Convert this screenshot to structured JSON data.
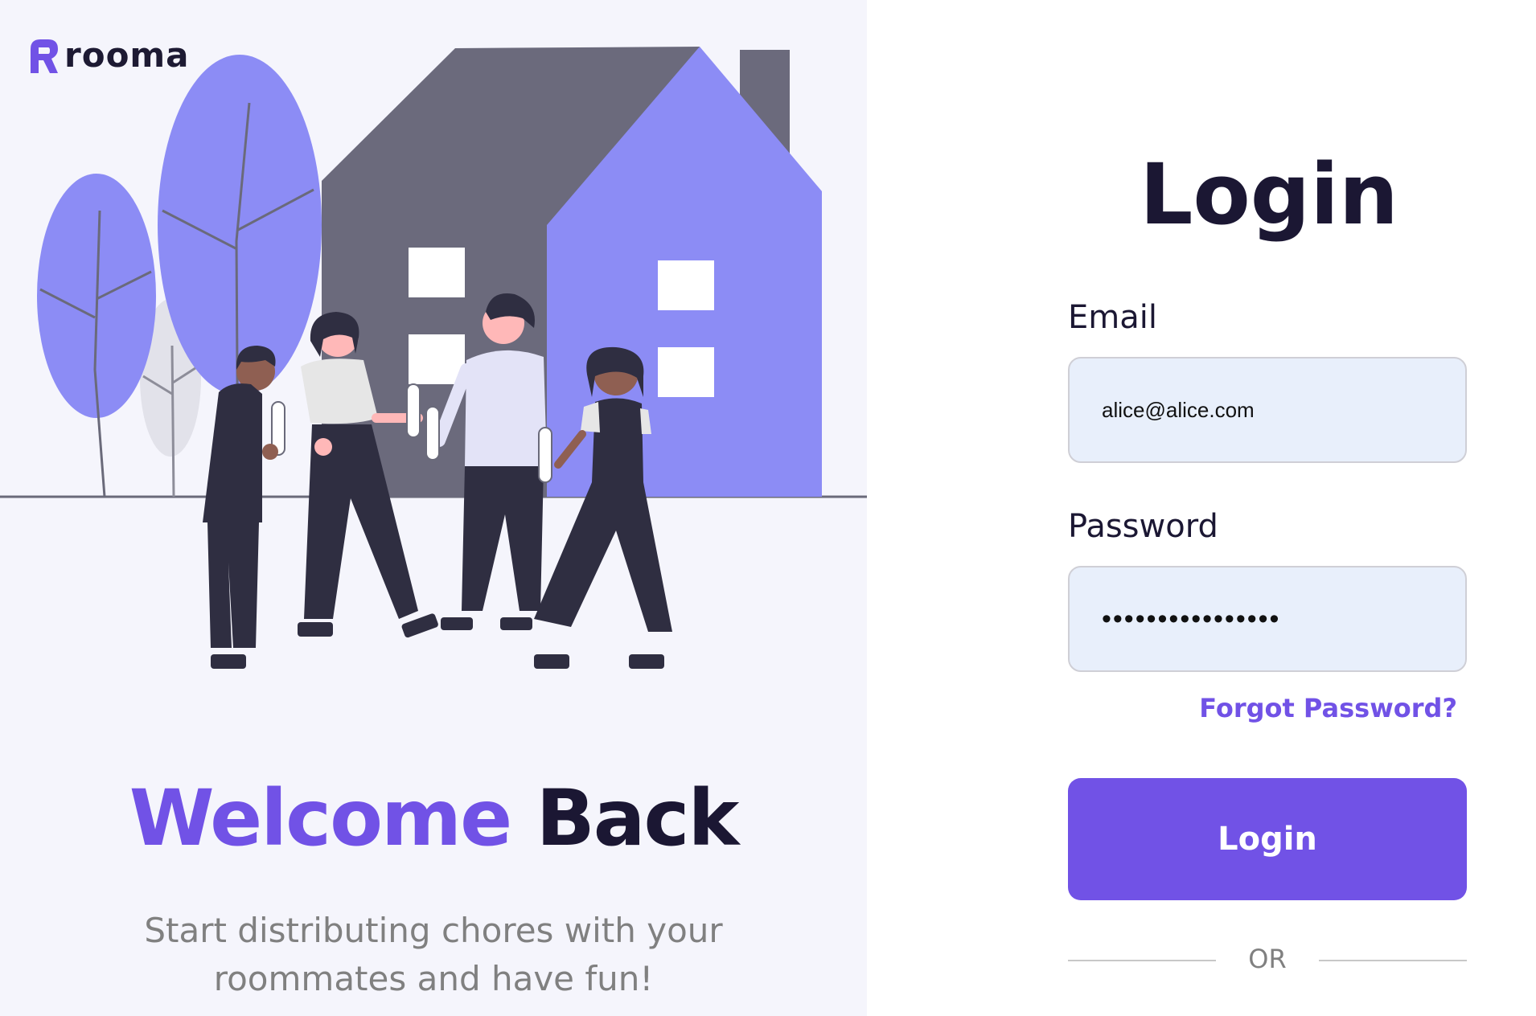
{
  "brand": {
    "name": "rooma",
    "accent_color": "#7152e6",
    "dark_color": "#1b1733"
  },
  "hero": {
    "welcome_part1": "Welcome",
    "welcome_part2": "Back",
    "subtitle": "Start distributing chores with your roommates and have fun!"
  },
  "login_form": {
    "title": "Login",
    "email_label": "Email",
    "email_value": "alice@alice.com",
    "password_label": "Password",
    "password_value": "••••••••••••••••",
    "forgot_password": "Forgot Password?",
    "submit_label": "Login",
    "or_text": "OR"
  }
}
